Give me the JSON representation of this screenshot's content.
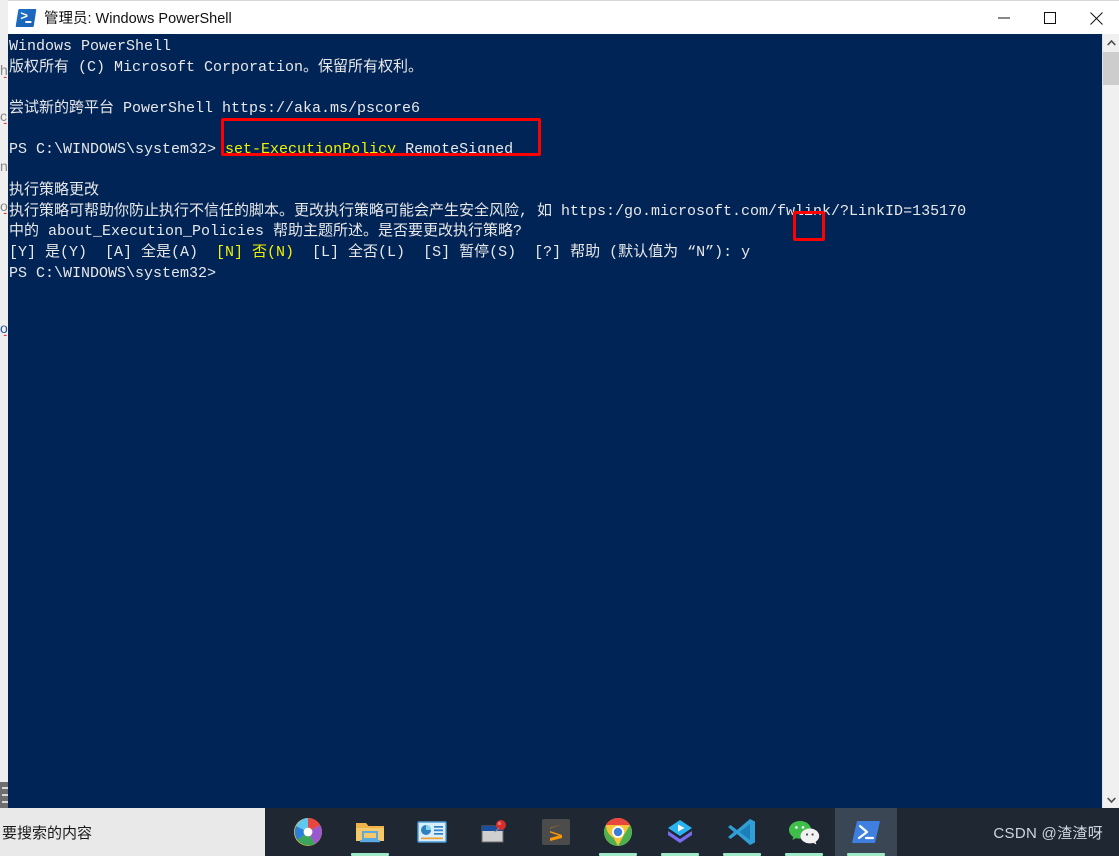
{
  "window": {
    "title": "管理员: Windows PowerShell",
    "icon": "powershell-icon",
    "controls": {
      "minimize": "minimize-icon",
      "maximize": "maximize-icon",
      "close": "close-icon"
    }
  },
  "console": {
    "background_color": "#012456",
    "foreground_color": "#e8e8e8",
    "highlight_color": "#f2f200",
    "lines": [
      {
        "id": "line-banner-1",
        "segments": [
          {
            "text": "Windows PowerShell",
            "color": "default"
          }
        ]
      },
      {
        "id": "line-banner-2",
        "segments": [
          {
            "text": "版权所有 (C) Microsoft Corporation。保留所有权利。",
            "color": "default"
          }
        ]
      },
      {
        "id": "line-blank-1",
        "segments": [
          {
            "text": "",
            "color": "default"
          }
        ]
      },
      {
        "id": "line-banner-3",
        "segments": [
          {
            "text": "尝试新的跨平台 PowerShell https://aka.ms/pscore6",
            "color": "default"
          }
        ]
      },
      {
        "id": "line-blank-2",
        "segments": [
          {
            "text": "",
            "color": "default"
          }
        ]
      },
      {
        "id": "line-command",
        "segments": [
          {
            "text": "PS C:\\WINDOWS\\system32> ",
            "color": "default"
          },
          {
            "text": "set-ExecutionPolicy",
            "color": "yellow"
          },
          {
            "text": " RemoteSigned",
            "color": "default"
          }
        ]
      },
      {
        "id": "line-blank-3",
        "segments": [
          {
            "text": "",
            "color": "default"
          }
        ]
      },
      {
        "id": "line-prompt-title",
        "segments": [
          {
            "text": "执行策略更改",
            "color": "default"
          }
        ]
      },
      {
        "id": "line-prompt-body-1",
        "segments": [
          {
            "text": "执行策略可帮助你防止执行不信任的脚本。更改执行策略可能会产生安全风险, 如 https:/go.microsoft.com/fwlink/?LinkID=135170",
            "color": "default"
          }
        ]
      },
      {
        "id": "line-prompt-body-2",
        "segments": [
          {
            "text": "中的 about_Execution_Policies 帮助主题所述。是否要更改执行策略?",
            "color": "default"
          }
        ]
      },
      {
        "id": "line-choices",
        "segments": [
          {
            "text": "[Y] 是(Y)  [A] 全是(A)  ",
            "color": "default"
          },
          {
            "text": "[N] 否(N)",
            "color": "yellow"
          },
          {
            "text": "  [L] 全否(L)  [S] 暂停(S)  [?] 帮助 (默认值为 “N”): ",
            "color": "default"
          },
          {
            "text": "y",
            "color": "default"
          }
        ]
      },
      {
        "id": "line-final-prompt",
        "segments": [
          {
            "text": "PS C:\\WINDOWS\\system32>",
            "color": "default"
          }
        ]
      }
    ],
    "scrollbar": {
      "up_arrow": "chevron-up-icon",
      "down_arrow": "chevron-down-icon"
    }
  },
  "annotations": [
    {
      "id": "annot-command",
      "target": "set-ExecutionPolicy RemoteSigned",
      "color": "#ff0000"
    },
    {
      "id": "annot-answer",
      "target": "y",
      "color": "#ff0000"
    }
  ],
  "taskbar": {
    "search_placeholder": "要搜索的内容",
    "background_color": "#1f2733",
    "items": [
      {
        "id": "task-chrome-canary",
        "name": "chrome-canary-icon",
        "label": "Chrome Canary",
        "active": false,
        "running": false
      },
      {
        "id": "task-file-explorer",
        "name": "file-explorer-icon",
        "label": "文件资源管理器",
        "active": false,
        "running": true
      },
      {
        "id": "task-presentation",
        "name": "presentation-app-icon",
        "label": "演示文稿",
        "active": false,
        "running": false
      },
      {
        "id": "task-pinned-window",
        "name": "pinned-window-icon",
        "label": "便签窗口",
        "active": false,
        "running": false
      },
      {
        "id": "task-sublime-text",
        "name": "sublime-text-icon",
        "label": "Sublime Text",
        "active": false,
        "running": false
      },
      {
        "id": "task-google-chrome",
        "name": "google-chrome-icon",
        "label": "Google Chrome",
        "active": false,
        "running": true
      },
      {
        "id": "task-media-player",
        "name": "media-player-icon",
        "label": "媒体播放器",
        "active": false,
        "running": true
      },
      {
        "id": "task-vscode",
        "name": "vscode-icon",
        "label": "Visual Studio Code",
        "active": false,
        "running": true
      },
      {
        "id": "task-wechat",
        "name": "wechat-icon",
        "label": "微信",
        "active": false,
        "running": true
      },
      {
        "id": "task-powershell",
        "name": "powershell-icon",
        "label": "Windows PowerShell",
        "active": true,
        "running": true
      }
    ]
  },
  "watermark": "CSDN @渣渣呀",
  "background_window": {
    "fragments": [
      "h",
      "c",
      "na",
      "on",
      "on"
    ]
  }
}
